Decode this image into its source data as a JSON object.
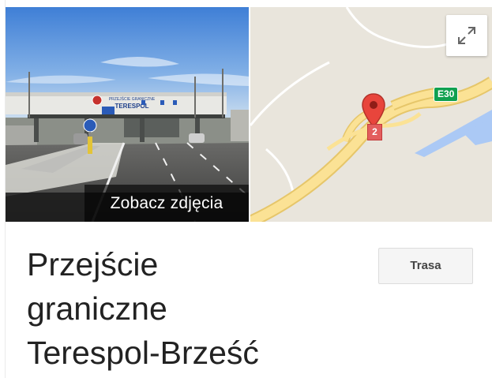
{
  "photo": {
    "label": "Zobacz zdjęcia",
    "sign_line1": "PRZEJŚCIE GRANICZNE",
    "sign_line2": "TERESPOL"
  },
  "map": {
    "road_label": "E30",
    "exit_number": "2",
    "expand_icon": "expand-icon",
    "pin_icon": "map-pin-icon",
    "colors": {
      "land": "#e9e5dc",
      "road": "#fbe295",
      "water": "#abc9f5",
      "road_shield": "#10a050",
      "pin": "#e8453c"
    }
  },
  "place": {
    "title_lines": [
      "Przejście",
      "graniczne",
      "Terespol-Brześć"
    ]
  },
  "actions": {
    "route_label": "Trasa"
  }
}
